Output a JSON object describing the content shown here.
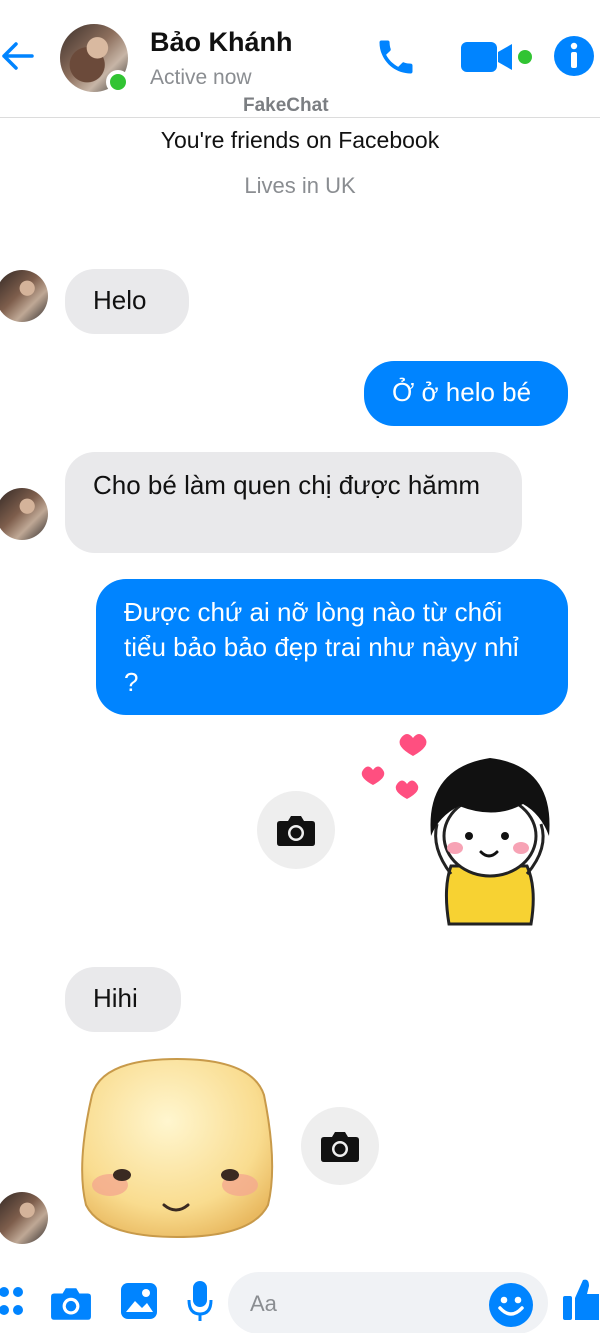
{
  "header": {
    "contact_name": "Bảo Khánh",
    "status": "Active now",
    "watermark": "FakeChat"
  },
  "intro": {
    "friends_text": "You're friends on Facebook",
    "lives_text": "Lives in UK"
  },
  "messages": [
    {
      "direction": "incoming",
      "text": "Helo"
    },
    {
      "direction": "outgoing",
      "text": "Ở ở helo bé"
    },
    {
      "direction": "incoming",
      "text": "Cho bé làm quen chị được hămm"
    },
    {
      "direction": "outgoing",
      "text": "Được chứ ai nỡ lòng nào từ chối tiểu bảo bảo đẹp trai như nàyy nhỉ ?"
    },
    {
      "direction": "outgoing",
      "type": "sticker",
      "sticker": "girl-hearts-sticker"
    },
    {
      "direction": "incoming",
      "text": "Hihi"
    },
    {
      "direction": "incoming",
      "type": "sticker",
      "sticker": "blushing-face-sticker"
    }
  ],
  "composer": {
    "placeholder": "Aa"
  },
  "colors": {
    "accent": "#0084ff",
    "online": "#31c433",
    "incoming_bubble": "#e9e9eb",
    "muted_text": "#8a8d91"
  },
  "icons": [
    "back-arrow-icon",
    "phone-icon",
    "video-camera-icon",
    "info-icon",
    "camera-icon",
    "menu-dots-icon",
    "photo-icon",
    "microphone-icon",
    "emoji-icon",
    "thumbs-up-icon"
  ]
}
